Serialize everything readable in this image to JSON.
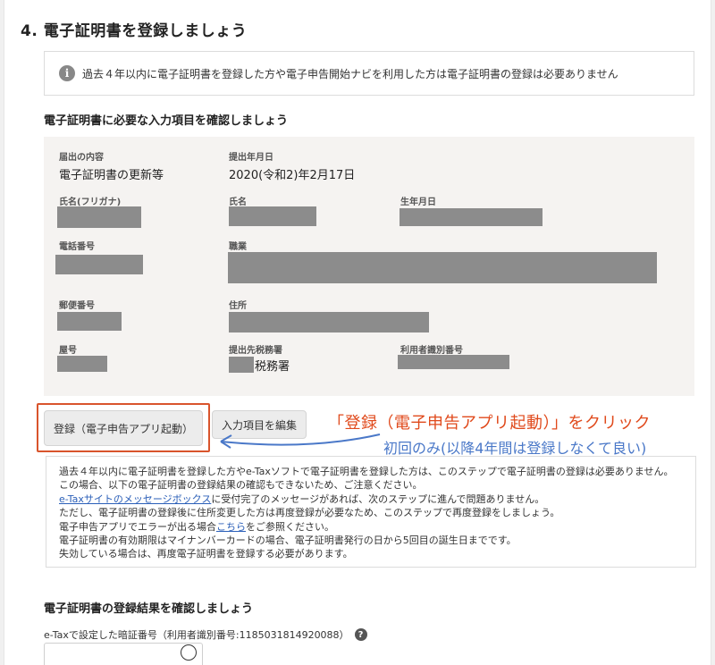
{
  "step": {
    "title": "4.  電子証明書を登録しましょう"
  },
  "info": {
    "icon": "info-icon",
    "icon_glyph": "i",
    "text": "過去４年以内に電子証明書を登録した方や電子申告開始ナビを利用した方は電子証明書の登録は必要ありません"
  },
  "confirm": {
    "title": "電子証明書に必要な入力項目を確認しましょう",
    "filing_content_label": "届出の内容",
    "filing_content_value": "電子証明書の更新等",
    "submit_date_label": "提出年月日",
    "submit_date_value": "2020(令和2)年2月17日",
    "kana_name_label": "氏名(フリガナ)",
    "name_label": "氏名",
    "birth_date_label": "生年月日",
    "phone_label": "電話番号",
    "occupation_label": "職業",
    "postal_code_label": "郵便番号",
    "address_label": "住所",
    "trade_name_label": "屋号",
    "tax_office_label": "提出先税務署",
    "tax_office_suffix": "税務署",
    "user_id_label": "利用者識別番号"
  },
  "buttons": {
    "register": "登録（電子申告アプリ起動）",
    "edit": "入力項目を編集"
  },
  "annotations": {
    "click_note": "「登録（電子申告アプリ起動）」をクリック",
    "first_time_note": "初回のみ(以降4年間は登録しなくて良い)",
    "red_color": "#e04a1c",
    "blue_color": "#4a78c8"
  },
  "notice": {
    "line1": "過去４年以内に電子証明書を登録した方やe-Taxソフトで電子証明書を登録した方は、このステップで電子証明書の登録は必要ありません。",
    "line2": "この場合、以下の電子証明書の登録結果の確認もできないため、ご注意ください。",
    "line3_link": "e-Taxサイトのメッセージボックス",
    "line3_rest": "に受付完了のメッセージがあれば、次のステップに進んで問題ありません。",
    "line4": "ただし、電子証明書の登録後に住所変更した方は再度登録が必要なため、このステップで再度登録をしましょう。",
    "line5_pre": "電子申告アプリでエラーが出る場合",
    "line5_link": "こちら",
    "line5_post": "をご参照ください。",
    "line6": "電子証明書の有効期限はマイナンバーカードの場合、電子証明書発行の日から5回目の誕生日までです。",
    "line7": "失効している場合は、再度電子証明書を登録する必要があります。"
  },
  "result": {
    "title": "電子証明書の登録結果を確認しましょう",
    "passcode_label": "e-Taxで設定した暗証番号（利用者識別番号:1185031814920088）",
    "help_icon": "question-icon",
    "help_glyph": "?",
    "eye_icon": "eye-icon"
  }
}
